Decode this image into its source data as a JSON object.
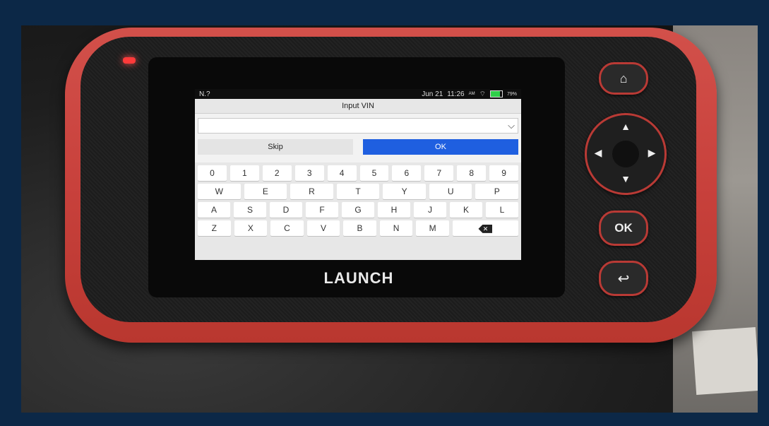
{
  "status": {
    "left_text": "N.?",
    "date": "Jun 21",
    "time": "11:26",
    "time_suffix": "AM",
    "battery": "79%",
    "battery_level": 0.79
  },
  "dialog": {
    "title": "Input VIN",
    "vin_value": "",
    "skip_label": "Skip",
    "ok_label": "OK"
  },
  "keyboard": {
    "row1": [
      "0",
      "1",
      "2",
      "3",
      "4",
      "5",
      "6",
      "7",
      "8",
      "9"
    ],
    "row2": [
      "W",
      "E",
      "R",
      "T",
      "Y",
      "U",
      "P"
    ],
    "row3": [
      "A",
      "S",
      "D",
      "F",
      "G",
      "H",
      "J",
      "K",
      "L"
    ],
    "row4": [
      "Z",
      "X",
      "C",
      "V",
      "B",
      "N",
      "M"
    ]
  },
  "device": {
    "brand": "LAUNCH",
    "ok_button": "OK",
    "icons": {
      "home": "home-icon",
      "back": "back-icon",
      "chevron": "chevron-down-icon"
    }
  }
}
